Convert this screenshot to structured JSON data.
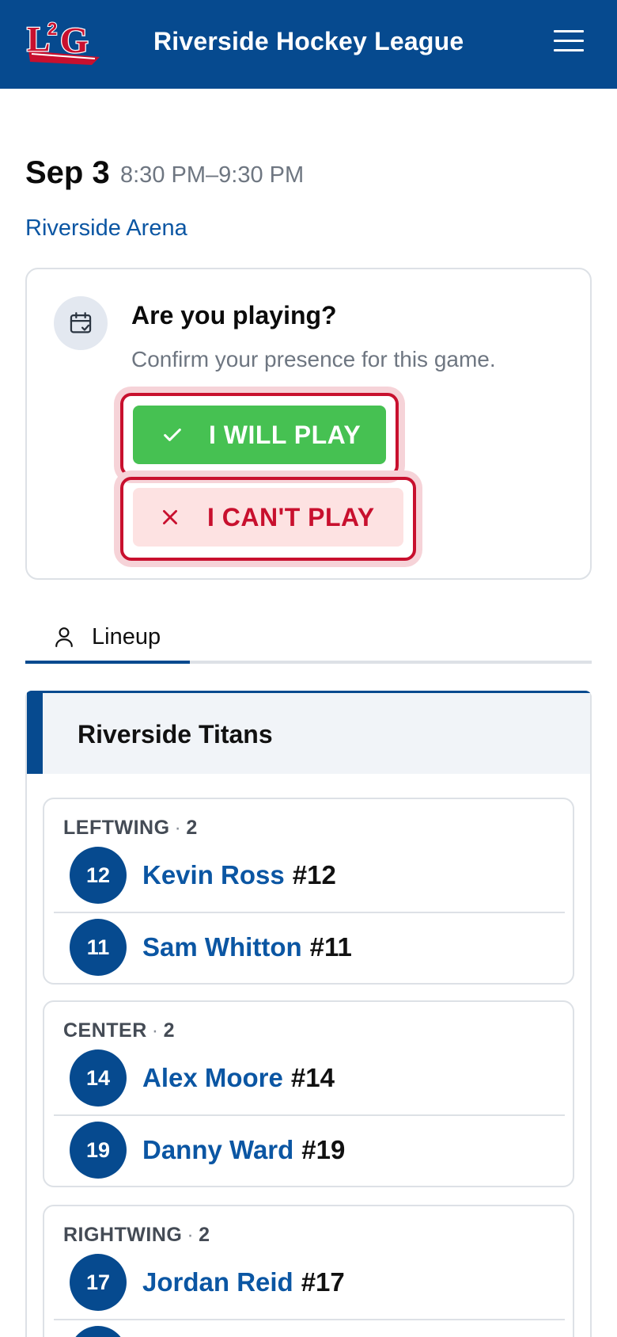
{
  "header": {
    "title": "Riverside Hockey League",
    "logo_text": "L2G",
    "logo_colors": {
      "red": "#c8102e",
      "white": "#ffffff",
      "blue": "#064a8f"
    },
    "menu_icon": "hamburger-icon"
  },
  "game": {
    "date": "Sep 3",
    "time": "8:30 PM–9:30 PM",
    "venue": "Riverside Arena"
  },
  "rsvp": {
    "icon": "calendar-check-icon",
    "title": "Are you playing?",
    "subtitle": "Confirm your presence for this game.",
    "will_play_label": "I WILL PLAY",
    "will_play_icon": "check-icon",
    "cant_play_label": "I CAN'T PLAY",
    "cant_play_icon": "x-icon"
  },
  "tabs": [
    {
      "label": "Lineup",
      "icon": "user-icon",
      "active": true
    }
  ],
  "team": {
    "name": "Riverside Titans",
    "groups": [
      {
        "position": "LEFTWING",
        "count": "2",
        "players": [
          {
            "number": "12",
            "name": "Kevin Ross",
            "jersey": "#12"
          },
          {
            "number": "11",
            "name": "Sam Whitton",
            "jersey": "#11"
          }
        ]
      },
      {
        "position": "CENTER",
        "count": "2",
        "players": [
          {
            "number": "14",
            "name": "Alex Moore",
            "jersey": "#14"
          },
          {
            "number": "19",
            "name": "Danny Ward",
            "jersey": "#19"
          }
        ]
      },
      {
        "position": "RIGHTWING",
        "count": "2",
        "players": [
          {
            "number": "17",
            "name": "Jordan Reid",
            "jersey": "#17"
          },
          {
            "number": "",
            "name": "",
            "jersey": ""
          }
        ]
      }
    ]
  },
  "colors": {
    "primary": "#064a8f",
    "link": "#0b56a3",
    "success": "#46c152",
    "danger": "#c8102e",
    "danger_bg": "#fde2e2",
    "muted": "#6e7681"
  }
}
